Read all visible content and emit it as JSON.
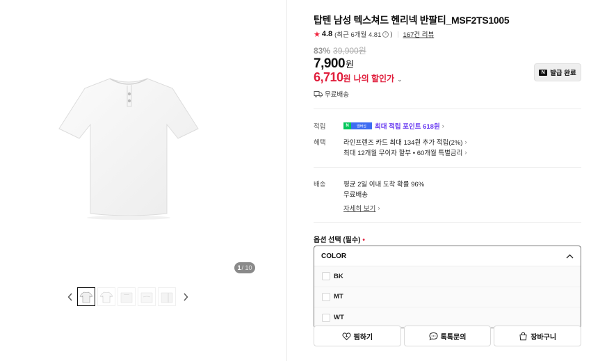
{
  "gallery": {
    "counter_current": "1",
    "counter_total": "/ 10",
    "prev_arrow": "‹",
    "next_arrow": "›"
  },
  "product": {
    "title": "탑텐 남성 텍스쳐드 헨리넥 반팔티_MSF2TS1005",
    "rating": "4.8",
    "recent_rating": "(최근 6개월 4.81",
    "info_icon": "i",
    "recent_rating_close": ")",
    "reviews": "167건 리뷰",
    "discount_rate": "83%",
    "original_price": "39,900원",
    "price": "7,900",
    "price_unit": "원",
    "my_price": "6,710",
    "my_price_unit": "원",
    "my_price_label": "나의 할인가",
    "my_price_chevron": "⌄",
    "coupon_button": "발급 완료",
    "coupon_icon_letter": "N",
    "shipping": "무료배송"
  },
  "benefits": {
    "points_label": "적립",
    "npay_n": "N",
    "npay_badge_text": "멤버십",
    "points_value": "최대 적립 포인트 618원",
    "benefit_label": "혜택",
    "benefit_line1": "라인프렌즈 카드 최대 134원 추가 적립(2%)",
    "benefit_line2": "최대 12개월 무이자 할부 • 60개월 특별금리",
    "chevron": "›"
  },
  "delivery": {
    "label": "배송",
    "line1": "평균 2일 이내 도착 확률 96%",
    "line2": "무료배송",
    "details_link": "자세히 보기"
  },
  "options": {
    "label": "옵션 선택 (필수)",
    "required_mark": "•",
    "dropdown_title": "COLOR",
    "items": [
      {
        "label": "BK"
      },
      {
        "label": "MT"
      },
      {
        "label": "WT"
      }
    ]
  },
  "actions": {
    "wishlist": "찜하기",
    "talk": "톡톡문의",
    "cart": "장바구니"
  },
  "colors": {
    "accent_red": "#e01e3c",
    "star_red": "#f0203a",
    "purple": "#6a3cf1",
    "npay_green": "#03c75a",
    "npay_blue": "#3d6cf2"
  }
}
